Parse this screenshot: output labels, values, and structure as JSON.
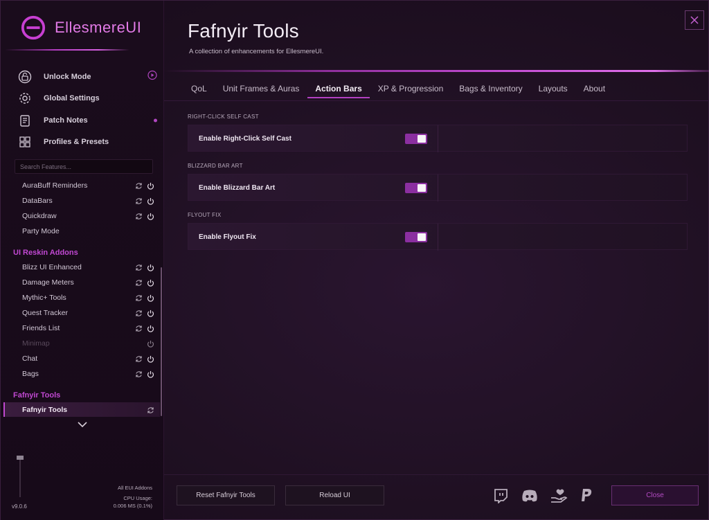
{
  "brand": {
    "name": "EllesmereUI"
  },
  "nav": [
    {
      "label": "Unlock Mode",
      "icon": "unlock-icon",
      "right": "play"
    },
    {
      "label": "Global Settings",
      "icon": "gear-icon",
      "right": ""
    },
    {
      "label": "Patch Notes",
      "icon": "notes-icon",
      "right": "dot"
    },
    {
      "label": "Profiles & Presets",
      "icon": "grid-icon",
      "right": ""
    }
  ],
  "search": {
    "placeholder": "Search Features..."
  },
  "modules": {
    "top": [
      {
        "label": "AuraBuff Reminders"
      },
      {
        "label": "DataBars"
      },
      {
        "label": "Quickdraw"
      },
      {
        "label": "Party Mode"
      }
    ],
    "group1_title": "UI Reskin Addons",
    "group1": [
      {
        "label": "Blizz UI Enhanced"
      },
      {
        "label": "Damage Meters"
      },
      {
        "label": "Mythic+ Tools"
      },
      {
        "label": "Quest Tracker"
      },
      {
        "label": "Friends List"
      },
      {
        "label": "Minimap"
      },
      {
        "label": "Chat"
      },
      {
        "label": "Bags"
      }
    ],
    "group2_title": "Fafnyir Tools",
    "group2": [
      {
        "label": "Fafnyir Tools"
      }
    ]
  },
  "footer": {
    "version": "v9.0.6",
    "all_addons": "All EUI Addons",
    "cpu_label": "CPU Usage:",
    "cpu_value": "0.006 MS (0.1%)"
  },
  "page": {
    "title": "Fafnyir Tools",
    "subtitle": "A collection of enhancements for EllesmereUI."
  },
  "tabs": [
    "QoL",
    "Unit Frames & Auras",
    "Action Bars",
    "XP & Progression",
    "Bags & Inventory",
    "Layouts",
    "About"
  ],
  "active_tab": "Action Bars",
  "sections": [
    {
      "heading": "RIGHT-CLICK SELF CAST",
      "option": "Enable Right-Click Self Cast",
      "enabled": true
    },
    {
      "heading": "BLIZZARD BAR ART",
      "option": "Enable Blizzard Bar Art",
      "enabled": true
    },
    {
      "heading": "FLYOUT FIX",
      "option": "Enable Flyout Fix",
      "enabled": true
    }
  ],
  "buttons": {
    "reset": "Reset Fafnyir Tools",
    "reload": "Reload UI",
    "close": "Close"
  },
  "social": [
    "twitch-icon",
    "discord-icon",
    "donate-icon",
    "paypal-icon"
  ],
  "colors": {
    "accent": "#c048d0",
    "toggle_on": "#8b2fa0",
    "background": "#1f1022"
  }
}
